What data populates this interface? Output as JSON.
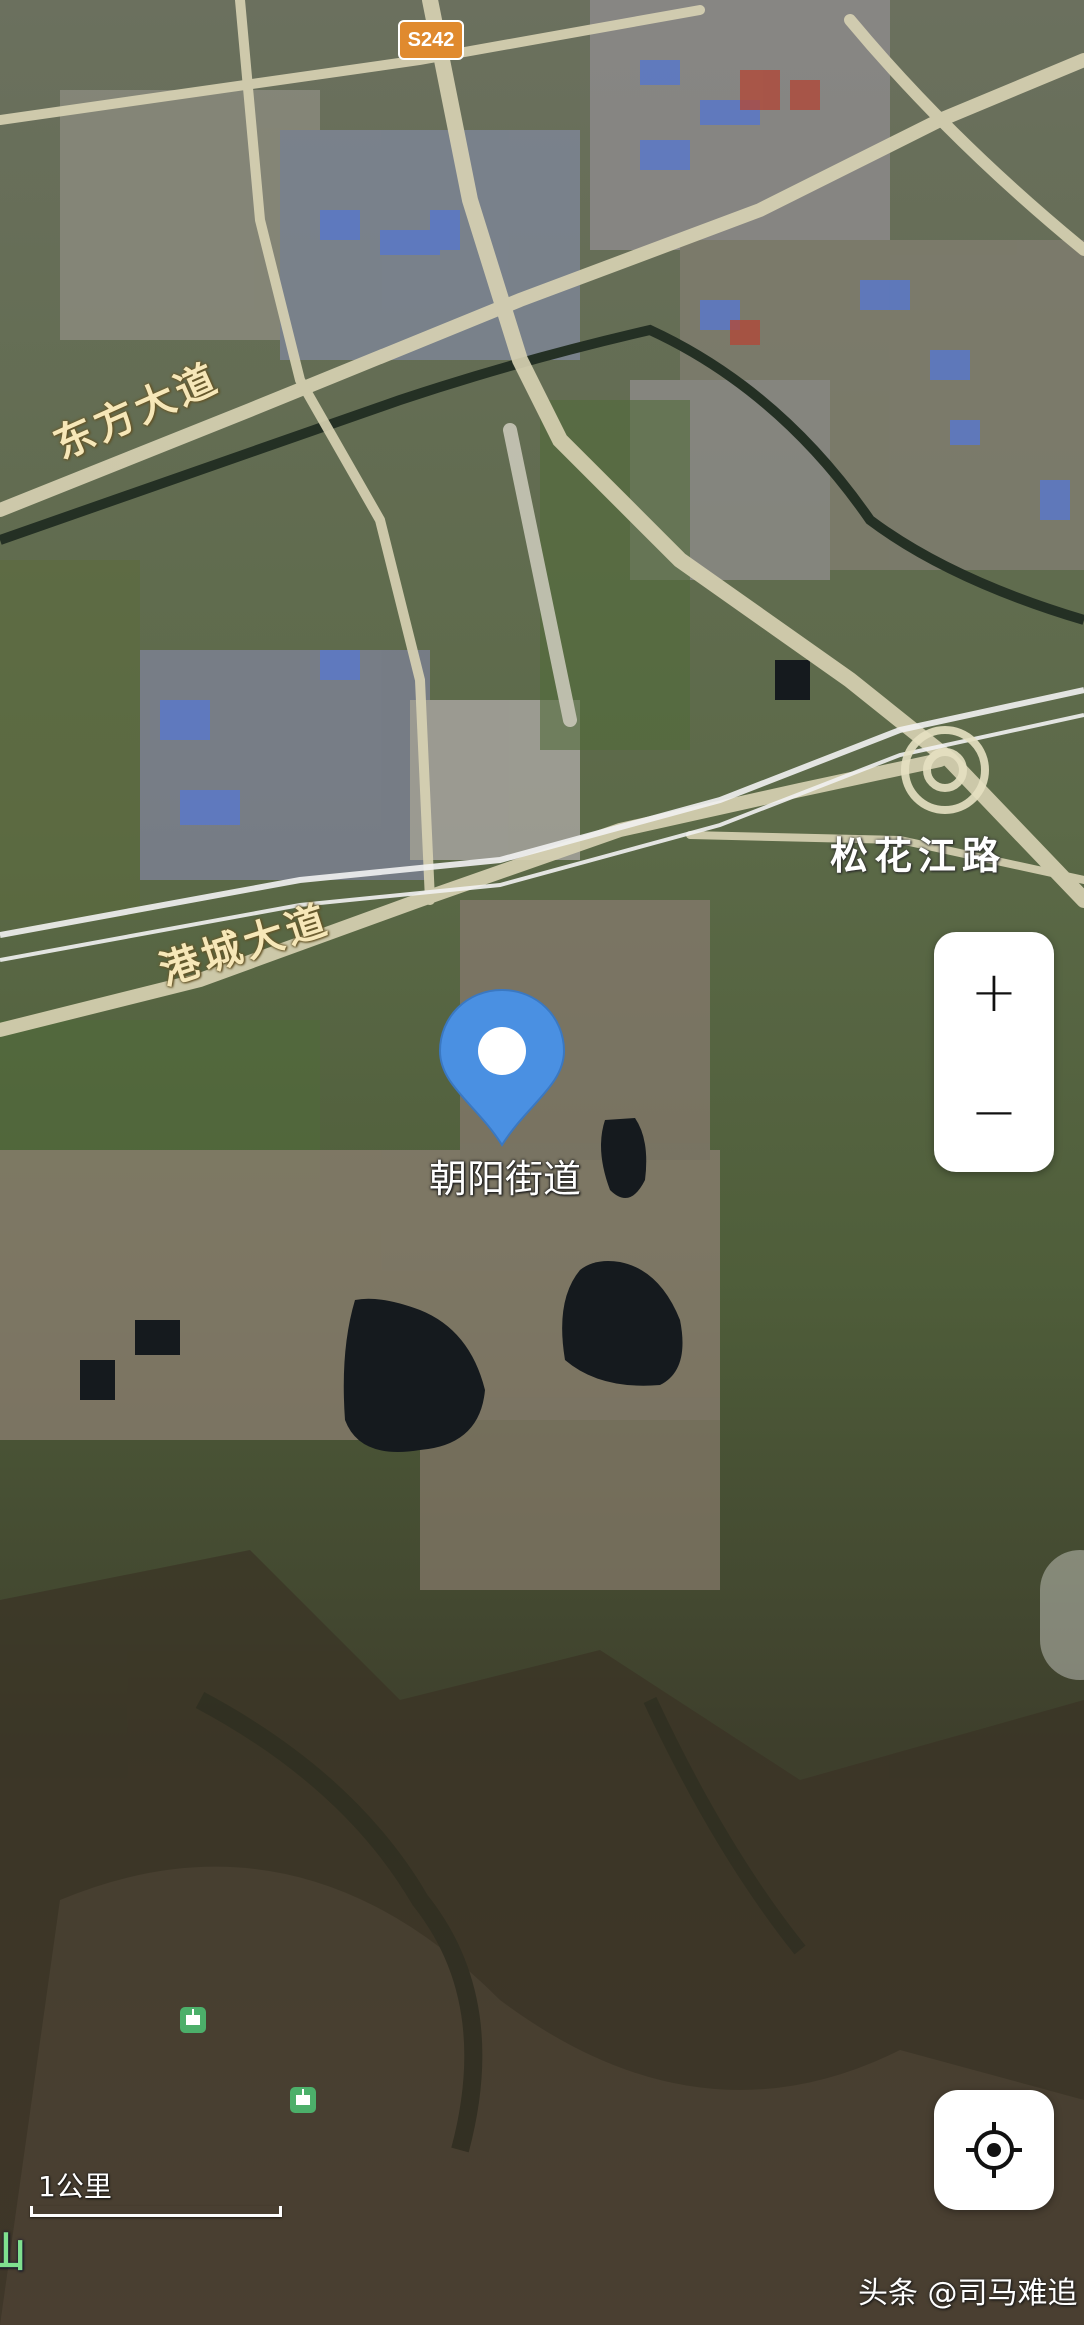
{
  "map": {
    "road_labels": {
      "dongfang_avenue": "东方大道",
      "gangcheng_avenue": "港城大道",
      "songhuajiang_road": "松花江路"
    },
    "highway_shield": "S242",
    "marker": {
      "label": "朝阳街道",
      "icon": "location-pin-icon",
      "color": "#4a90e2"
    },
    "scale": {
      "label": "1公里"
    },
    "mountain_label": "山",
    "poi_icons": [
      "cable-car-icon",
      "cable-car-icon"
    ]
  },
  "controls": {
    "zoom_in_symbol": "+",
    "zoom_out_symbol": "−",
    "locate_icon": "crosshair-icon"
  },
  "watermark": "头条 @司马难追",
  "colors": {
    "marker_blue": "#4a90e2",
    "shield_orange": "#e08a2e",
    "road_label_cream": "#f6e7b8",
    "poi_green": "#4caf6a"
  }
}
